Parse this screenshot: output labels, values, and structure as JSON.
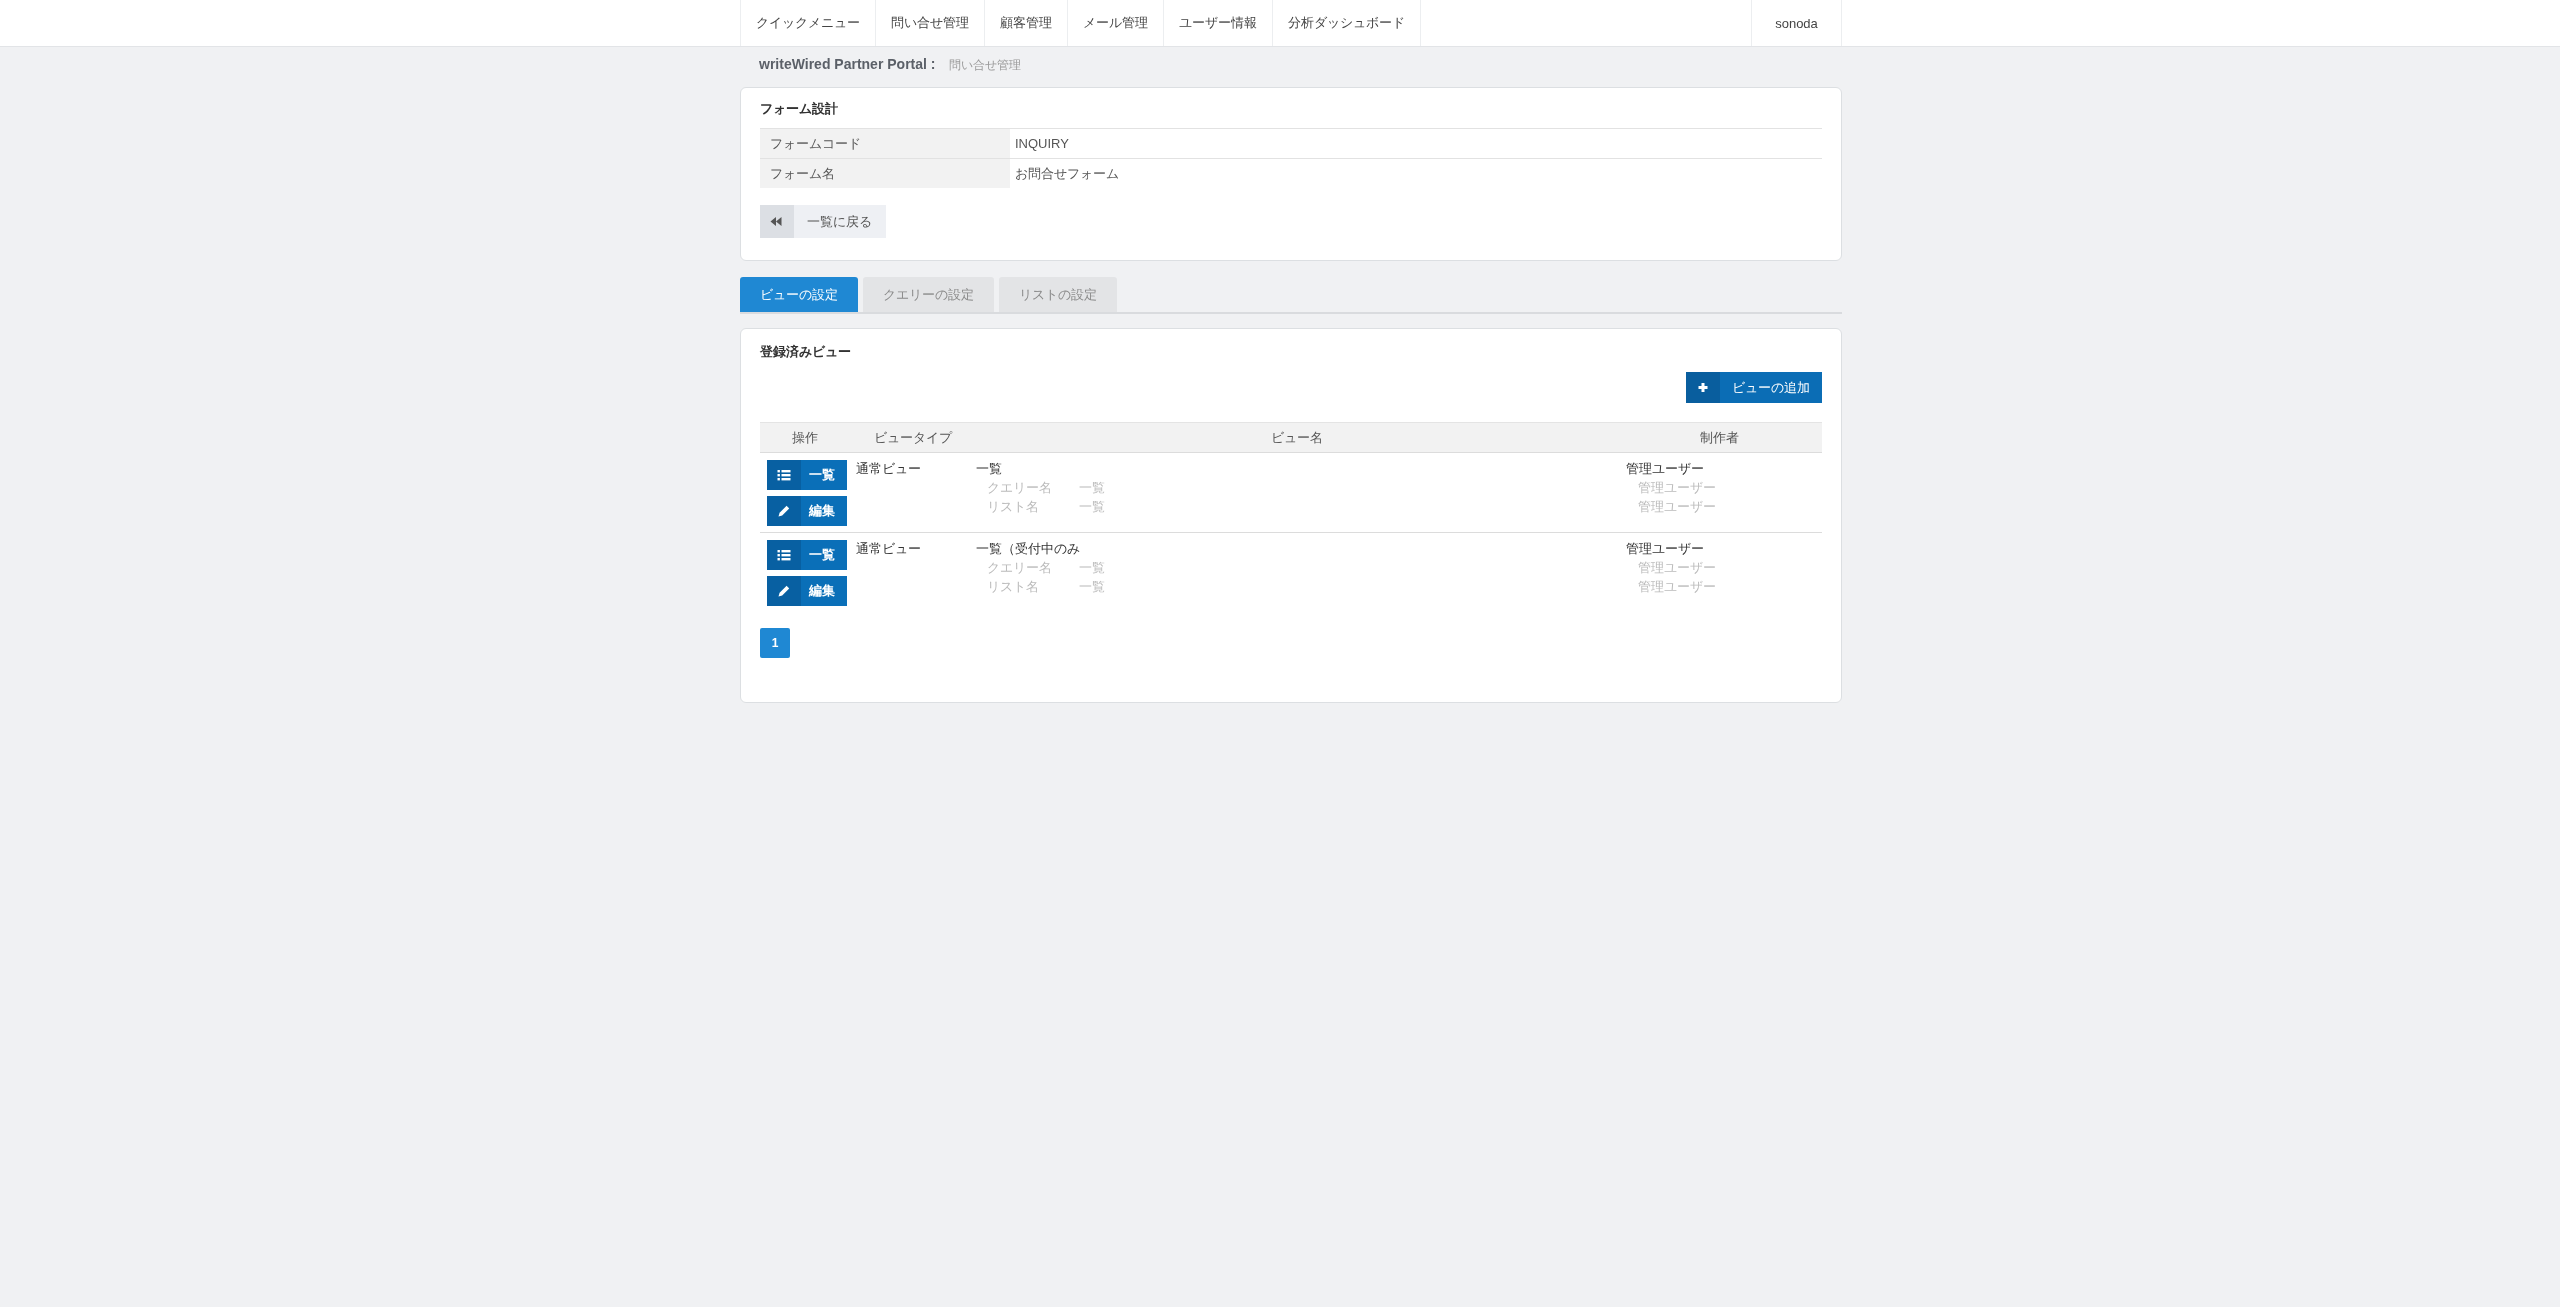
{
  "nav": {
    "items": [
      "クイックメニュー",
      "問い合せ管理",
      "顧客管理",
      "メール管理",
      "ユーザー情報",
      "分析ダッシュボード"
    ],
    "user": "sonoda"
  },
  "breadcrumb": {
    "site": "writeWired Partner Portal :",
    "page": "問い合せ管理"
  },
  "form_design": {
    "title": "フォーム設計",
    "fields": [
      {
        "label": "フォームコード",
        "value": "INQUIRY"
      },
      {
        "label": "フォーム名",
        "value": "お問合せフォーム"
      }
    ],
    "back_button": "一覧に戻る"
  },
  "tabs": [
    {
      "label": "ビューの設定",
      "selected": true
    },
    {
      "label": "クエリーの設定",
      "selected": false
    },
    {
      "label": "リストの設定",
      "selected": false
    }
  ],
  "views": {
    "title": "登録済みビュー",
    "add_button": "ビューの追加",
    "columns": [
      "操作",
      "ビュータイプ",
      "ビュー名",
      "制作者"
    ],
    "rows": [
      {
        "actions": [
          {
            "kind": "list",
            "label": "一覧"
          },
          {
            "kind": "edit",
            "label": "編集"
          }
        ],
        "view_type": "通常ビュー",
        "view_name": "一覧",
        "details": [
          {
            "label": "クエリー名",
            "value": "一覧"
          },
          {
            "label": "リスト名",
            "value": "一覧"
          }
        ],
        "author": "管理ユーザー",
        "author_details": [
          "管理ユーザー",
          "管理ユーザー"
        ]
      },
      {
        "actions": [
          {
            "kind": "list",
            "label": "一覧"
          },
          {
            "kind": "edit",
            "label": "編集"
          }
        ],
        "view_type": "通常ビュー",
        "view_name": "一覧（受付中のみ",
        "details": [
          {
            "label": "クエリー名",
            "value": "一覧"
          },
          {
            "label": "リスト名",
            "value": "一覧"
          }
        ],
        "author": "管理ユーザー",
        "author_details": [
          "管理ユーザー",
          "管理ユーザー"
        ]
      }
    ],
    "pagination": [
      {
        "label": "1",
        "selected": true
      }
    ]
  }
}
